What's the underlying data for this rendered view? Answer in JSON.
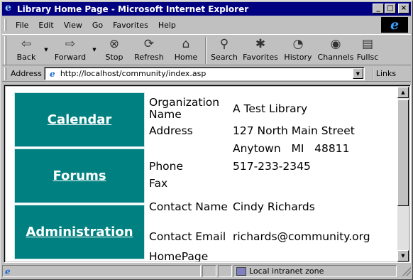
{
  "window": {
    "title": "Library Home Page - Microsoft Internet Explorer",
    "buttons": {
      "minimize": "_",
      "maximize": "□",
      "close": "×"
    }
  },
  "menu": [
    "File",
    "Edit",
    "View",
    "Go",
    "Favorites",
    "Help"
  ],
  "toolbar": {
    "back": "Back",
    "forward": "Forward",
    "stop": "Stop",
    "refresh": "Refresh",
    "home": "Home",
    "search": "Search",
    "favorites": "Favorites",
    "history": "History",
    "channels": "Channels",
    "fullscreen": "Fullsc"
  },
  "address": {
    "label": "Address",
    "url": "http://localhost/community/index.asp",
    "links_label": "Links"
  },
  "nav": [
    "Calendar",
    "Forums",
    "Administration"
  ],
  "info": {
    "org_label": "Organization Name",
    "org_value": "A Test Library",
    "address_label": "Address",
    "address_line1": "127 North Main Street",
    "address_line2": "Anytown   MI   48811",
    "phone_label": "Phone",
    "phone_value": "517-233-2345",
    "fax_label": "Fax",
    "fax_value": "",
    "contact_name_label": "Contact Name",
    "contact_name_value": "Cindy Richards",
    "contact_email_label": "Contact Email",
    "contact_email_value": "richards@community.org",
    "homepage_label": "HomePage"
  },
  "status": {
    "text": "",
    "zone": "Local intranet zone"
  }
}
